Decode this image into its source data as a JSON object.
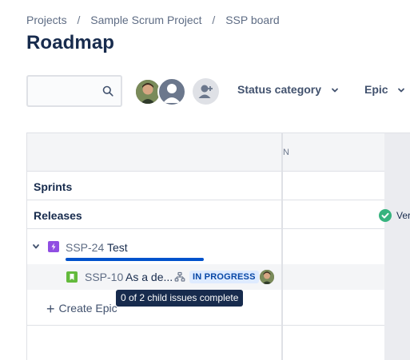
{
  "breadcrumb": {
    "items": [
      "Projects",
      "Sample Scrum Project",
      "SSP board"
    ],
    "separator": "/"
  },
  "page": {
    "title": "Roadmap"
  },
  "search": {
    "value": "",
    "placeholder": ""
  },
  "filters": {
    "status_category": "Status category",
    "epic": "Epic"
  },
  "timeline": {
    "month_label_partial": "N",
    "rows": {
      "sprints": "Sprints",
      "releases": "Releases"
    },
    "release_marker": {
      "label": "Ver",
      "color": "#36b37e"
    }
  },
  "epic": {
    "key": "SSP-24",
    "summary": "Test",
    "icon": "epic-lightning-icon",
    "color": "#904ee2",
    "progress_fraction": 1.0
  },
  "child": {
    "key": "SSP-10",
    "summary": "As a de...",
    "icon": "story-bookmark-icon",
    "color": "#63ba3c",
    "status": "IN PROGRESS"
  },
  "create_epic": {
    "label": "Create Epic"
  },
  "tooltip": {
    "text": "0 of 2 child issues complete"
  }
}
